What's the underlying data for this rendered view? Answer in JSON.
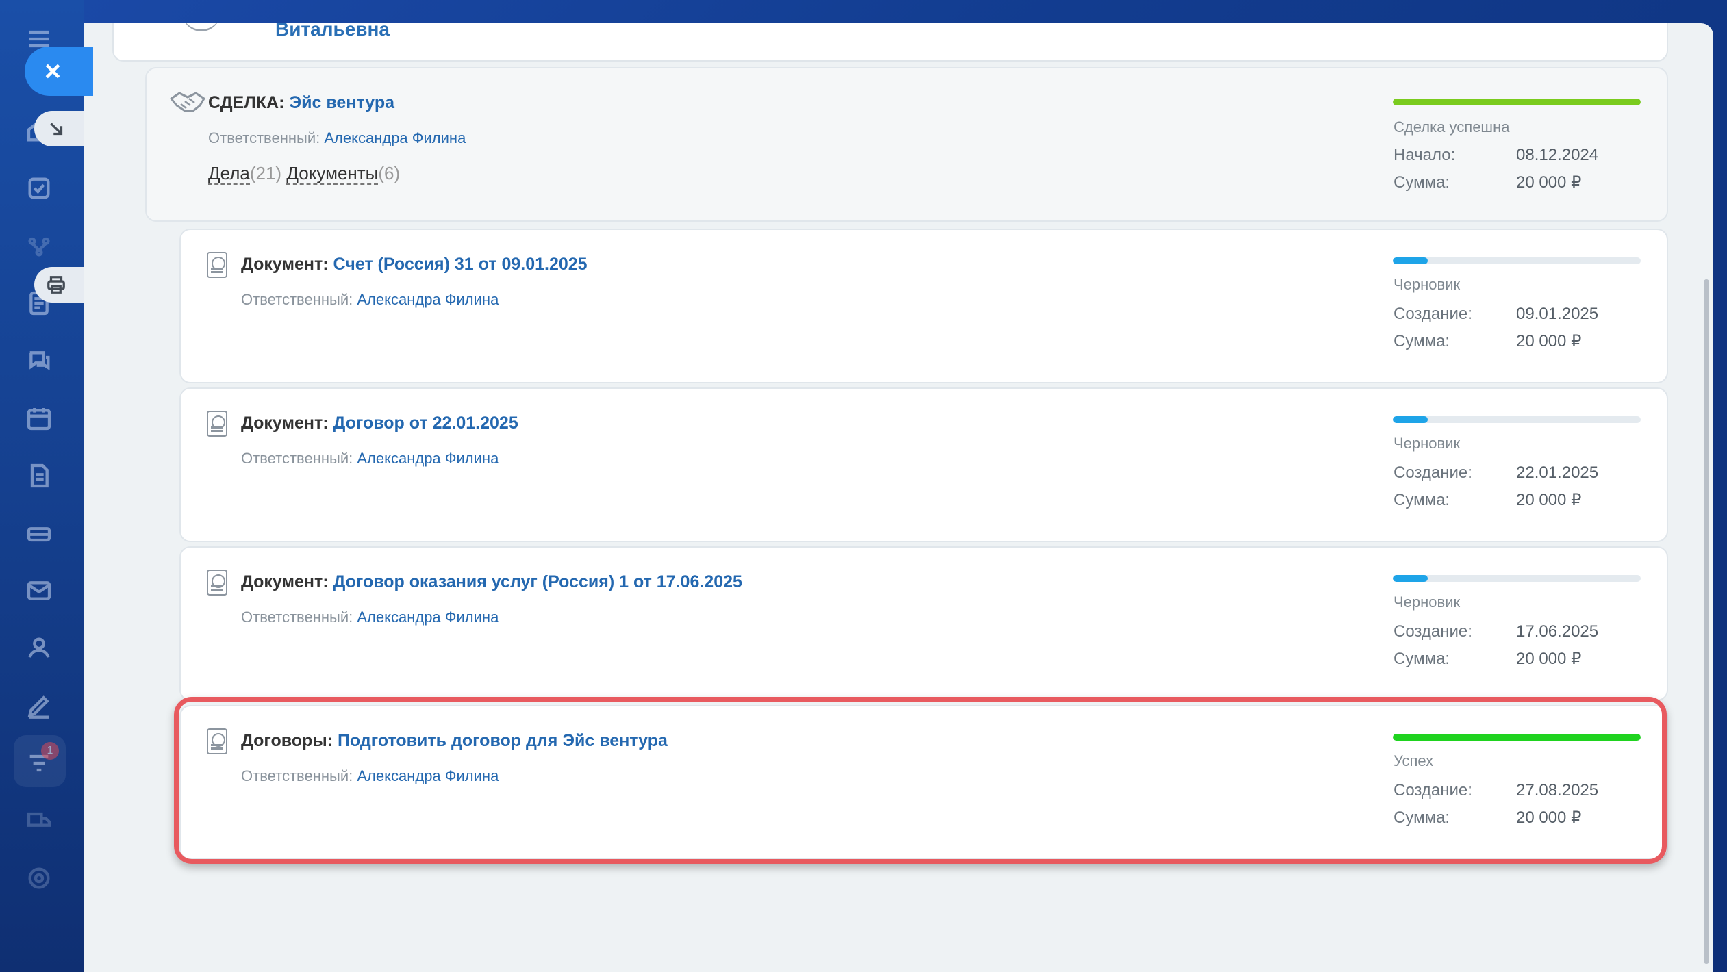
{
  "sidebar": {
    "icons": [
      "menu-icon",
      "home-icon",
      "tasks-icon",
      "crm-icon",
      "documents-icon",
      "chat-icon",
      "calendar-icon",
      "file-icon",
      "inventory-icon",
      "mail-icon",
      "contacts-icon",
      "signature-icon",
      "filter-icon",
      "delivery-icon",
      "settings-icon"
    ],
    "badge_count": "1"
  },
  "top_card": {
    "name": "Витальевна"
  },
  "deal": {
    "prefix": "СДЕЛКА:",
    "title": "Эйс вентура",
    "responsible_label": "Ответственный:",
    "responsible": "Александра Филина",
    "tasks_label": "Дела",
    "tasks_count": "(21)",
    "docs_label": "Документы",
    "docs_count": "(6)",
    "stage": "Сделка успешна",
    "stage_progress": 1.0,
    "stage_color": "#7acb1e",
    "date_label": "Начало:",
    "date": "08.12.2024",
    "sum_label": "Сумма:",
    "sum": "20 000 ₽"
  },
  "items": [
    {
      "prefix": "Документ:",
      "title": "Счет (Россия) 31 от 09.01.2025",
      "responsible_label": "Ответственный:",
      "responsible": "Александра Филина",
      "stage": "Черновик",
      "stage_progress": 0.14,
      "stage_color": "#1ea4e8",
      "date_label": "Создание:",
      "date": "09.01.2025",
      "sum_label": "Сумма:",
      "sum": "20 000 ₽"
    },
    {
      "prefix": "Документ:",
      "title": "Договор от 22.01.2025",
      "responsible_label": "Ответственный:",
      "responsible": "Александра Филина",
      "stage": "Черновик",
      "stage_progress": 0.14,
      "stage_color": "#1ea4e8",
      "date_label": "Создание:",
      "date": "22.01.2025",
      "sum_label": "Сумма:",
      "sum": "20 000 ₽"
    },
    {
      "prefix": "Документ:",
      "title": "Договор оказания услуг (Россия) 1 от 17.06.2025",
      "responsible_label": "Ответственный:",
      "responsible": "Александра Филина",
      "stage": "Черновик",
      "stage_progress": 0.14,
      "stage_color": "#1ea4e8",
      "date_label": "Создание:",
      "date": "17.06.2025",
      "sum_label": "Сумма:",
      "sum": "20 000 ₽"
    },
    {
      "prefix": "Договоры:",
      "title": "Подготовить договор для Эйс вентура",
      "responsible_label": "Ответственный:",
      "responsible": "Александра Филина",
      "stage": "Успех",
      "stage_progress": 1.0,
      "stage_color": "#1fd31f",
      "date_label": "Создание:",
      "date": "27.08.2025",
      "sum_label": "Сумма:",
      "sum": "20 000 ₽"
    }
  ],
  "colors": {
    "accent": "#2a8af0",
    "link": "#2468b0",
    "highlight": "#e85a5f"
  }
}
